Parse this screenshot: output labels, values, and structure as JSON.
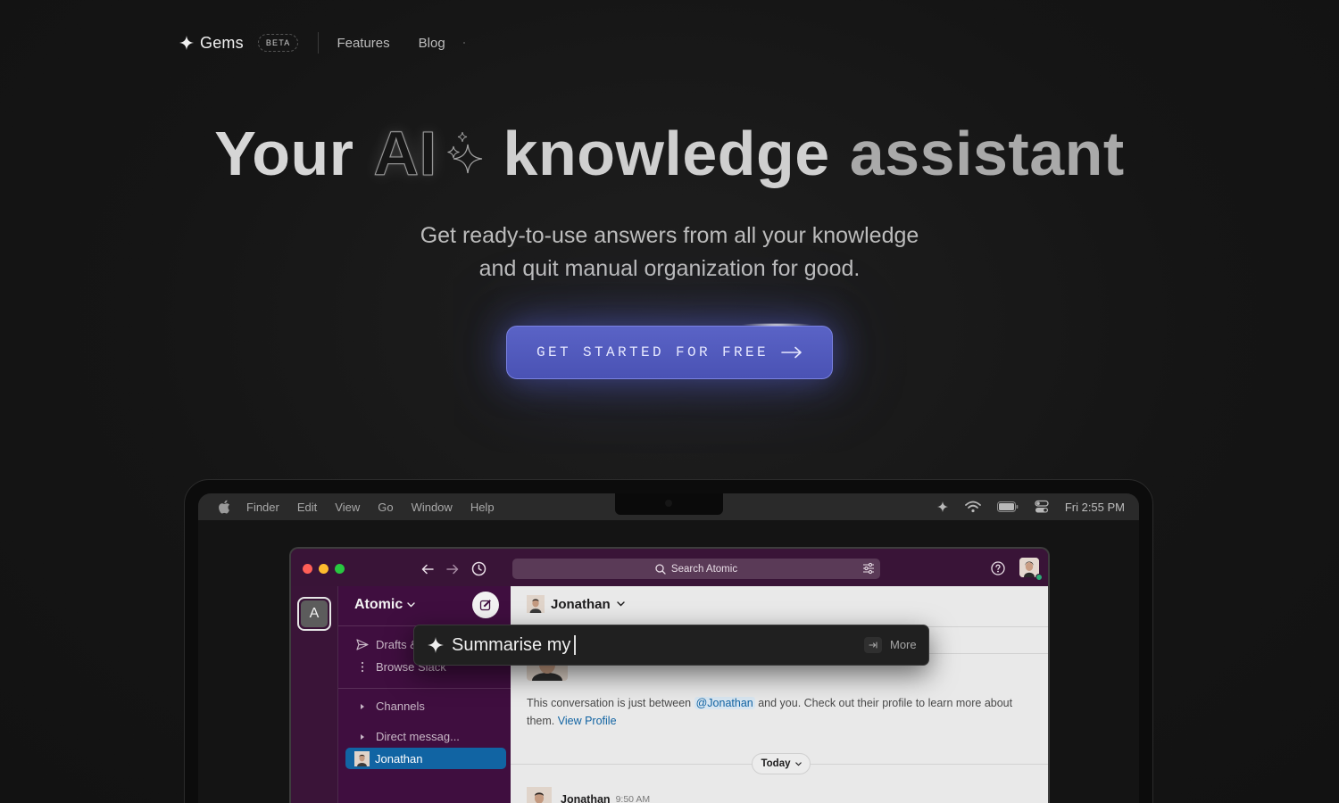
{
  "nav": {
    "brand": "Gems",
    "badge": "BETA",
    "links": [
      "Features",
      "Blog"
    ]
  },
  "hero": {
    "title_word_1": "Your",
    "title_ai": "AI",
    "title_word_3": "knowledge",
    "title_word_4": "assistant",
    "subtitle_line_1": "Get ready-to-use answers from all your knowledge",
    "subtitle_line_2": "and quit manual organization for good.",
    "cta_label": "GET STARTED FOR FREE"
  },
  "menubar": {
    "items": [
      "Finder",
      "Edit",
      "View",
      "Go",
      "Window",
      "Help"
    ],
    "clock": "Fri 2:55 PM"
  },
  "app": {
    "search_placeholder": "Search Atomic",
    "workspace_initial": "A",
    "workspace_name": "Atomic",
    "sidebar": {
      "drafts": "Drafts & sent",
      "browse": "Browse Slack",
      "channels": "Channels",
      "direct": "Direct messag...",
      "active_dm": "Jonathan"
    },
    "channel_title": "Jonathan",
    "intro_before": "This conversation is just between",
    "intro_mention": "@Jonathan",
    "intro_after": "and you. Check out their profile to learn more about them.",
    "intro_link": "View Profile",
    "today_label": "Today",
    "message_author": "Jonathan",
    "message_time": "9:50 AM"
  },
  "overlay": {
    "input_value": "Summarise my",
    "more_label": "More"
  },
  "colors": {
    "cta": "#4f57ba",
    "slack_aubergine": "#3f0e3f",
    "active_item": "#1164a3",
    "link": "#1264a3"
  }
}
